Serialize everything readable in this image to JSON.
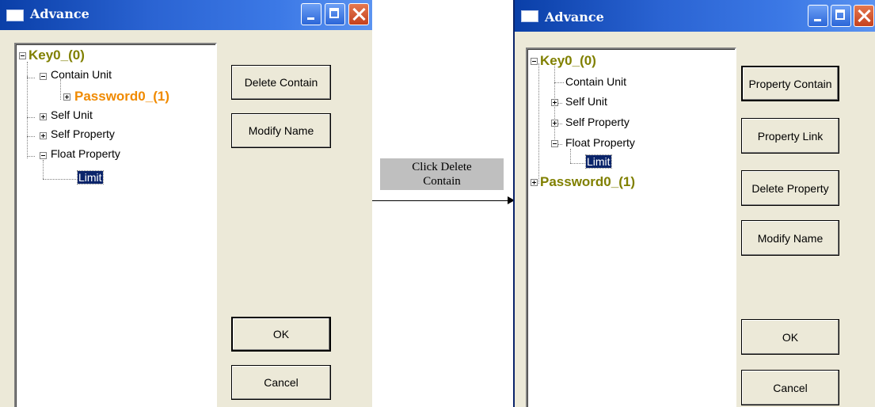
{
  "window_left": {
    "title": "Advance",
    "tree": {
      "root": "Key0_(0)",
      "contain_unit": "Contain Unit",
      "password": "Password0_(1)",
      "self_unit": "Self Unit",
      "self_property": "Self Property",
      "float_property": "Float Property",
      "limit": "Limit"
    },
    "buttons": {
      "delete_contain": "Delete Contain",
      "modify_name": "Modify Name",
      "ok": "OK",
      "cancel": "Cancel"
    }
  },
  "annotation": {
    "line1": "Click Delete",
    "line2": "Contain"
  },
  "window_right": {
    "title": "Advance",
    "tree": {
      "root": "Key0_(0)",
      "contain_unit": "Contain Unit",
      "self_unit": "Self Unit",
      "self_property": "Self Property",
      "float_property": "Float Property",
      "limit": "Limit",
      "password": "Password0_(1)"
    },
    "buttons": {
      "property_contain": "Property Contain",
      "property_link": "Property Link",
      "delete_property": "Delete Property",
      "modify_name": "Modify Name",
      "ok": "OK",
      "cancel": "Cancel"
    }
  }
}
